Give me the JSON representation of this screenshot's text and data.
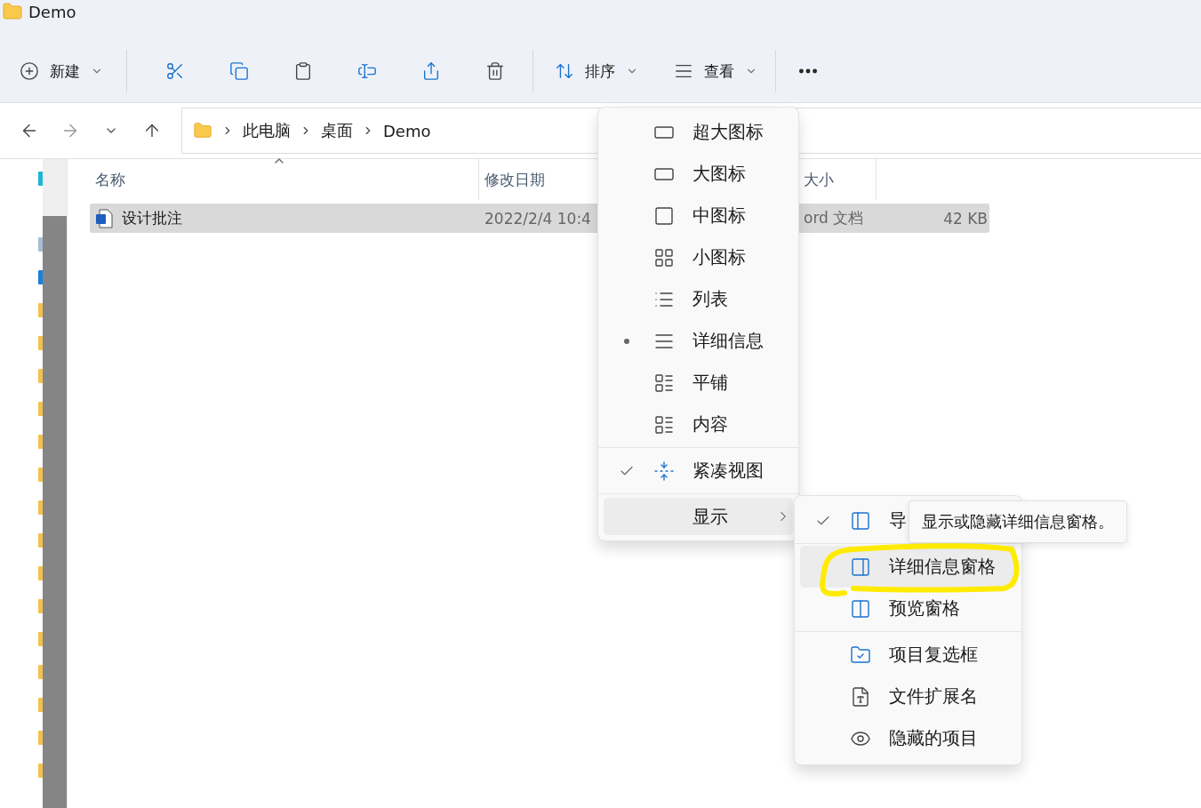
{
  "window": {
    "title": "Demo"
  },
  "toolbar": {
    "new": "新建",
    "sort": "排序",
    "view": "查看"
  },
  "breadcrumb": [
    "此电脑",
    "桌面",
    "Demo"
  ],
  "columns": [
    {
      "label": "名称",
      "sorted": true
    },
    {
      "label": "修改日期",
      "sorted": false
    },
    {
      "label": "大小",
      "sorted": false
    }
  ],
  "files": [
    {
      "name": "设计批注",
      "date": "2022/2/4 10:4",
      "type": "ord 文档",
      "size": "42 KB",
      "selected": true
    }
  ],
  "view_menu": {
    "groups": [
      {
        "items": [
          {
            "kind": "option",
            "label": "超大图标",
            "selected": false
          },
          {
            "kind": "option",
            "label": "大图标",
            "selected": false
          },
          {
            "kind": "option",
            "label": "中图标",
            "selected": false
          },
          {
            "kind": "option",
            "label": "小图标",
            "selected": false
          },
          {
            "kind": "option",
            "label": "列表",
            "selected": false
          },
          {
            "kind": "option",
            "label": "详细信息",
            "selected": true
          },
          {
            "kind": "option",
            "label": "平铺",
            "selected": false
          },
          {
            "kind": "option",
            "label": "内容",
            "selected": false
          }
        ]
      },
      {
        "items": [
          {
            "kind": "toggle",
            "label": "紧凑视图",
            "checked": true
          }
        ]
      },
      {
        "items": [
          {
            "kind": "submenu",
            "label": "显示",
            "hovered": true
          }
        ]
      }
    ]
  },
  "show_menu": {
    "groups": [
      {
        "items": [
          {
            "kind": "toggle",
            "label": "导",
            "checked": true,
            "hovered": false
          }
        ]
      },
      {
        "items": [
          {
            "kind": "toggle",
            "label": "详细信息窗格",
            "checked": false,
            "hovered": true
          },
          {
            "kind": "toggle",
            "label": "预览窗格",
            "checked": false,
            "hovered": false
          }
        ]
      },
      {
        "items": [
          {
            "kind": "toggle",
            "label": "项目复选框",
            "checked": false,
            "hovered": false
          },
          {
            "kind": "toggle",
            "label": "文件扩展名",
            "checked": false,
            "hovered": false
          },
          {
            "kind": "toggle",
            "label": "隐藏的项目",
            "checked": false,
            "hovered": false
          }
        ]
      }
    ]
  },
  "tooltip": "显示或隐藏详细信息窗格。"
}
